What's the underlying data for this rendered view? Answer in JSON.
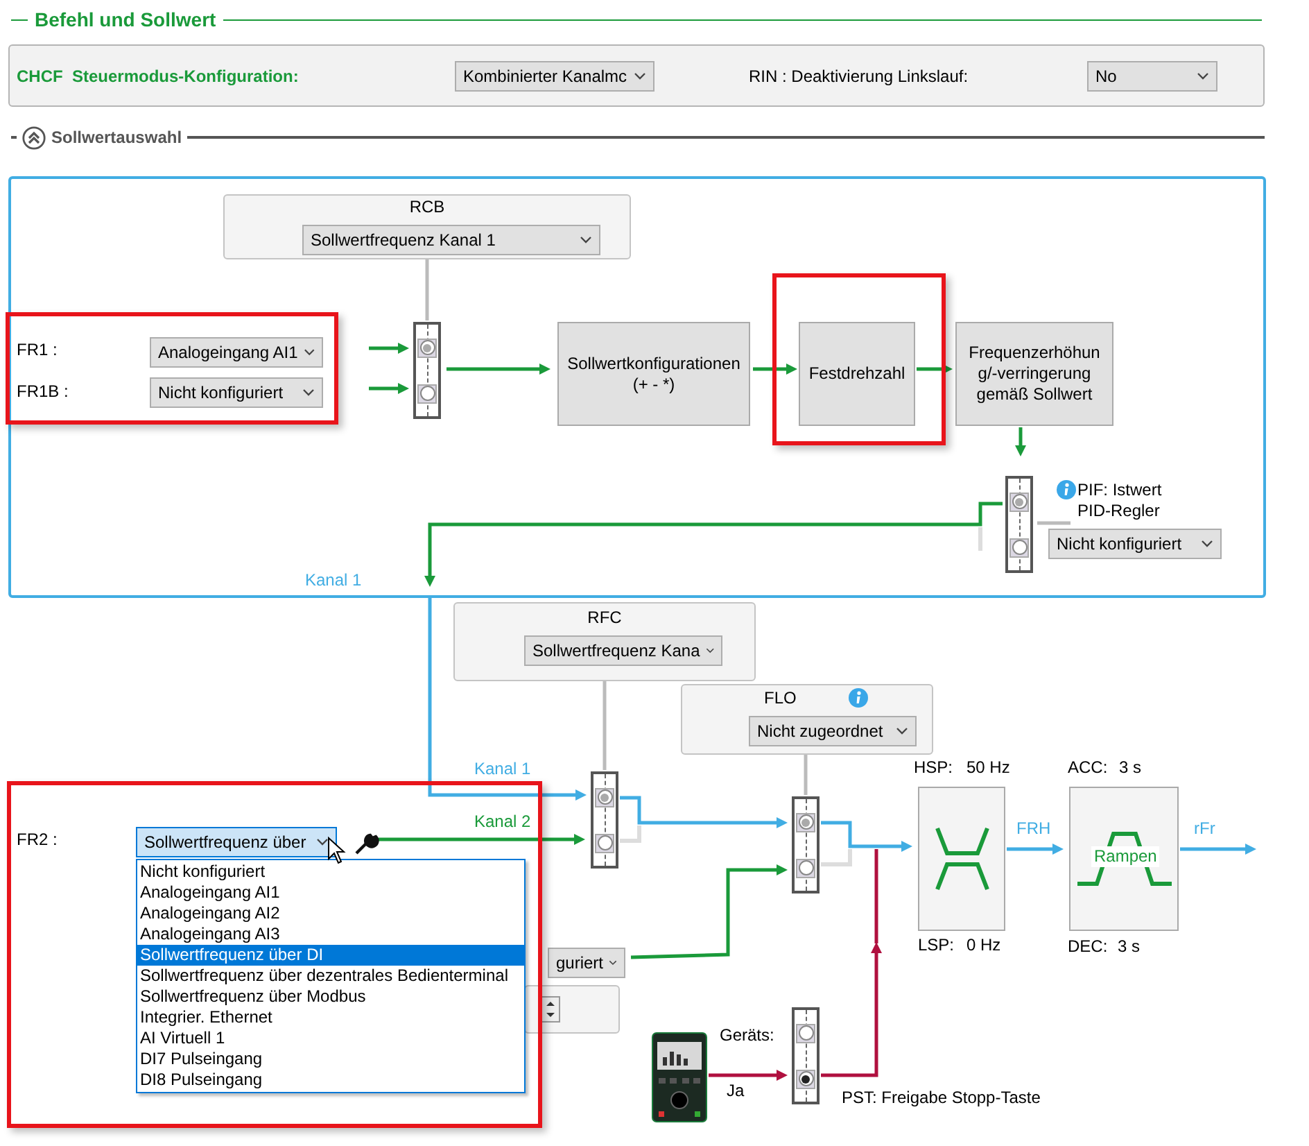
{
  "section_title": "Befehl und Sollwert",
  "config": {
    "code": "CHCF",
    "label": "Steuermodus-Konfiguration:",
    "mode": "Kombinierter Kanalmc",
    "rin_label": "RIN : Deaktivierung Linkslauf:",
    "rin": "No"
  },
  "subsection": {
    "title": "Sollwertauswahl",
    "expanded": true
  },
  "channel_1": {
    "rcb": {
      "title": "RCB",
      "value": "Sollwertfrequenz Kanal 1"
    },
    "inputs": {
      "highlighted": true,
      "items": [
        {
          "label": "FR1 :",
          "value": "Analogeingang AI1"
        },
        {
          "label": "FR1B :",
          "value": "Nicht konfiguriert"
        }
      ]
    },
    "input_switch": {
      "kind": "reference",
      "positions": [
        {
          "selected": true
        },
        {
          "selected": false
        }
      ]
    },
    "blocks": [
      {
        "lines": [
          "Sollwertkonfigurationen",
          "(+ - *)"
        ],
        "highlighted": false
      },
      {
        "lines": [
          "Festdrehzahl"
        ],
        "highlighted": true
      },
      {
        "lines": [
          "Frequenzerhöhun",
          "g/-verringerung",
          "gemäß Sollwert"
        ],
        "highlighted": false
      }
    ],
    "pid_switch": {
      "kind": "reference",
      "positions": [
        {
          "selected": true
        },
        {
          "selected": false
        }
      ]
    },
    "pif": {
      "lines": [
        "PIF: Istwert",
        "PID-Regler"
      ],
      "value": "Nicht konfiguriert"
    },
    "label": "Kanal 1"
  },
  "channel_2": {
    "rfc": {
      "title": "RFC",
      "value": "Sollwertfrequenz Kana"
    },
    "channel_switch": {
      "kind": "reference",
      "positions": [
        {
          "selected": true
        },
        {
          "selected": false
        }
      ]
    },
    "wire_labels": [
      "Kanal 1",
      "Kanal 2"
    ],
    "fr2": {
      "highlighted": true,
      "label": "FR2 :",
      "value": "Sollwertfrequenz über",
      "open": true,
      "options": [
        {
          "label": "Nicht konfiguriert",
          "selected": false
        },
        {
          "label": "Analogeingang AI1",
          "selected": false
        },
        {
          "label": "Analogeingang AI2",
          "selected": false
        },
        {
          "label": "Analogeingang AI3",
          "selected": false
        },
        {
          "label": "Sollwertfrequenz über DI",
          "selected": true
        },
        {
          "label": "Sollwertfrequenz über dezentrales Bedienterminal",
          "selected": false
        },
        {
          "label": "Sollwertfrequenz über Modbus",
          "selected": false
        },
        {
          "label": "Integrier. Ethernet",
          "selected": false
        },
        {
          "label": "AI Virtuell 1",
          "selected": false
        },
        {
          "label": "DI7 Pulseingang",
          "selected": false
        },
        {
          "label": "DI8 Pulseingang",
          "selected": false
        }
      ]
    },
    "covered_select": {
      "value": "guriert"
    },
    "flo": {
      "title": "FLO",
      "value": "Nicht zugeordnet"
    },
    "flo_switch": {
      "kind": "reference",
      "positions": [
        {
          "selected": true
        },
        {
          "selected": false
        }
      ]
    },
    "speed_limits": {
      "high_label": "HSP:",
      "high": "50 Hz",
      "low_label": "LSP:",
      "low": "0 Hz"
    },
    "frh": "FRH",
    "ramp": {
      "acc_label": "ACC:",
      "acc": "3 s",
      "dec_label": "DEC:",
      "dec": "3 s",
      "label": "Rampen"
    },
    "output": "rFr",
    "stop_key": {
      "device_label": "Geräts:",
      "yes_label": "Ja",
      "caption": "PST: Freigabe Stopp-Taste",
      "switch": {
        "kind": "enable",
        "positions": [
          {
            "selected": false
          },
          {
            "selected": true
          }
        ]
      }
    }
  }
}
